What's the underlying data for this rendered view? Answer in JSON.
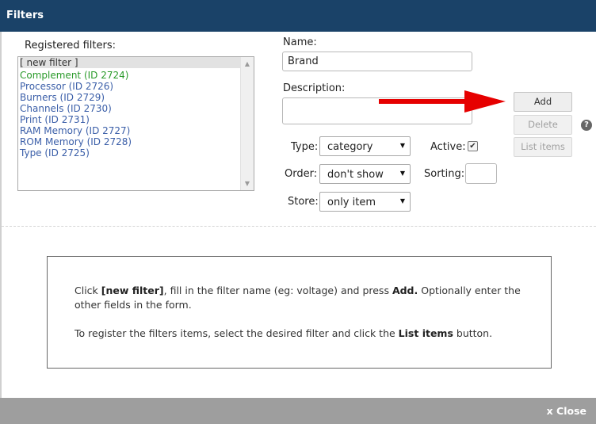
{
  "window": {
    "title": "Filters"
  },
  "registered": {
    "label": "Registered filters:",
    "items": [
      "[ new filter ]",
      "Complement (ID 2724)",
      "Processor (ID 2726)",
      "Burners (ID 2729)",
      "Channels (ID 2730)",
      "Print (ID 2731)",
      "RAM Memory (ID 2727)",
      "ROM Memory (ID 2728)",
      "Type (ID 2725)"
    ]
  },
  "form": {
    "name_label": "Name:",
    "name_value": "Brand",
    "description_label": "Description:",
    "description_value": "",
    "type_label": "Type:",
    "type_value": "category",
    "active_label": "Active:",
    "active_checked": true,
    "order_label": "Order:",
    "order_value": "don't show",
    "sorting_label": "Sorting:",
    "sorting_value": "",
    "store_label": "Store:",
    "store_value": "only item"
  },
  "buttons": {
    "add": "Add",
    "delete": "Delete",
    "list_items": "List items",
    "help": "?"
  },
  "info": {
    "line1": {
      "t1": "Click ",
      "b1": "[new filter]",
      "t2": ", fill in the filter name (eg: voltage) and press ",
      "b2": "Add.",
      "t3": " Optionally enter the other fields in the form."
    },
    "line2": {
      "t1": "To register the filters items, select the desired filter and click the ",
      "b1": "List items",
      "t2": " button."
    }
  },
  "footer": {
    "close": "x Close"
  },
  "colors": {
    "titlebar": "#1a4268",
    "footer": "#9e9e9e",
    "link": "#3a5ea8",
    "selected_green": "#2a9a2a",
    "arrow": "#e60000"
  }
}
